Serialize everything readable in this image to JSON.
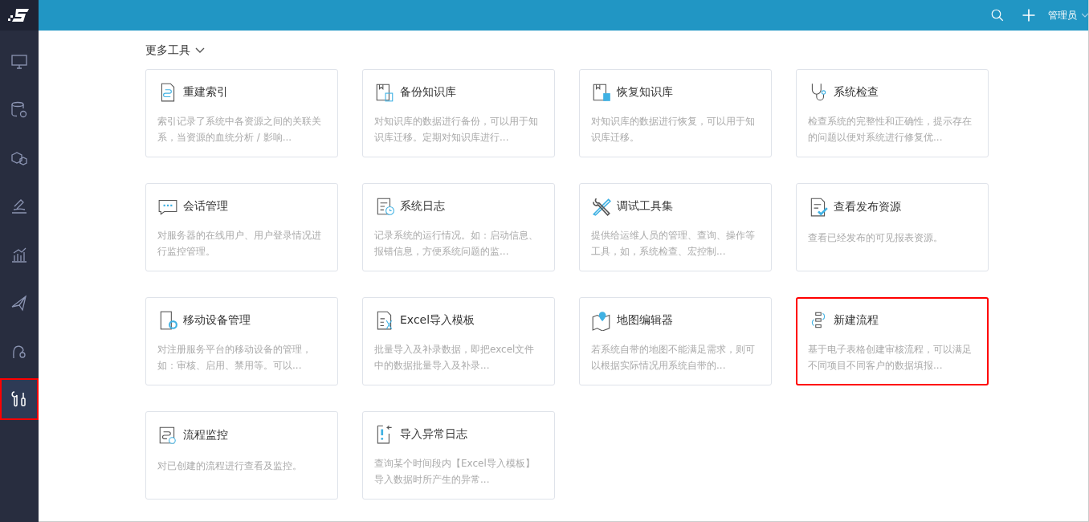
{
  "sidebar": {
    "items": [
      {
        "selected": false,
        "highlighted": false
      },
      {
        "selected": false,
        "highlighted": false
      },
      {
        "selected": false,
        "highlighted": false
      },
      {
        "selected": false,
        "highlighted": false
      },
      {
        "selected": false,
        "highlighted": false
      },
      {
        "selected": false,
        "highlighted": false
      },
      {
        "selected": false,
        "highlighted": false
      },
      {
        "selected": true,
        "highlighted": true
      }
    ]
  },
  "topbar": {
    "user": "管理员"
  },
  "section": {
    "title": "更多工具",
    "expanded": true
  },
  "cards": [
    {
      "title": "重建索引",
      "description": "索引记录了系统中各资源之间的关联关系，当资源的血统分析 / 影响...",
      "highlighted": false
    },
    {
      "title": "备份知识库",
      "description": "对知识库的数据进行备份，可以用于知识库迁移。定期对知识库进行...",
      "highlighted": false
    },
    {
      "title": "恢复知识库",
      "description": "对知识库的数据进行恢复，可以用于知识库迁移。",
      "highlighted": false
    },
    {
      "title": "系统检查",
      "description": "检查系统的完整性和正确性，提示存在的问题以便对系统进行修复优...",
      "highlighted": false
    },
    {
      "title": "会话管理",
      "description": "对服务器的在线用户、用户登录情况进行监控管理。",
      "highlighted": false
    },
    {
      "title": "系统日志",
      "description": "记录系统的运行情况。如：启动信息、报错信息，方便系统问题的监...",
      "highlighted": false
    },
    {
      "title": "调试工具集",
      "description": "提供给运维人员的管理、查询、操作等工具，如，系统检查、宏控制...",
      "highlighted": false
    },
    {
      "title": "查看发布资源",
      "description": "查看已经发布的可见报表资源。",
      "highlighted": false
    },
    {
      "title": "移动设备管理",
      "description": "对注册服务平台的移动设备的管理，如：审核、启用、禁用等。可以...",
      "highlighted": false
    },
    {
      "title": "Excel导入模板",
      "description": "批量导入及补录数据，即把excel文件中的数据批量导入及补录...",
      "highlighted": false
    },
    {
      "title": "地图编辑器",
      "description": "若系统自带的地图不能满足需求，则可以根据实际情况用系统自带的...",
      "highlighted": false
    },
    {
      "title": "新建流程",
      "description": "基于电子表格创建审核流程，可以满足不同项目不同客户的数据填报...",
      "highlighted": true
    },
    {
      "title": "流程监控",
      "description": "对已创建的流程进行查看及监控。",
      "highlighted": false
    },
    {
      "title": "导入异常日志",
      "description": "查询某个时间段内【Excel导入模板】导入数据时所产生的异常...",
      "highlighted": false
    }
  ]
}
